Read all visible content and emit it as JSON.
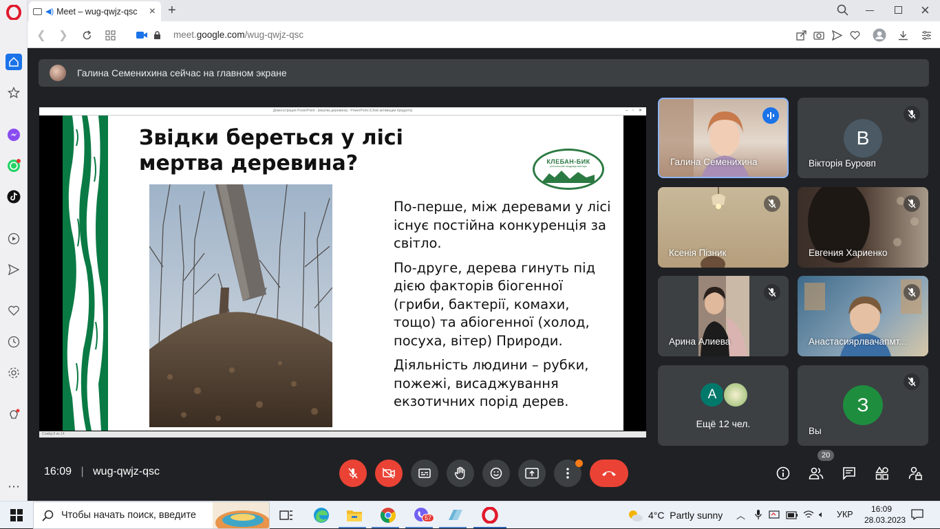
{
  "browser": {
    "tab_title": "Meet – wug-qwjz-qsc",
    "url_prefix": "meet.",
    "url_domain": "google.com",
    "url_path": "/wug-qwjz-qsc"
  },
  "sidebar": {
    "items": [
      "opera-logo",
      "home",
      "bookmarks",
      "messenger",
      "whatsapp",
      "tiktok",
      "player",
      "send",
      "favorites",
      "history",
      "settings",
      "ideas",
      "more"
    ]
  },
  "banner": {
    "text": "Галина Семенихина сейчас на главном экране"
  },
  "presentation": {
    "window_title": "Демонстрация PowerPoint - [мертва деревина] - PowerPoint (Сбой активации продукта)",
    "status_text": "Слайд 8 из 14",
    "slide": {
      "title_line1": "Звідки береться у лісі",
      "title_line2": "мертва деревина?",
      "logo_line1": "КЛЕБАН-БИК",
      "logo_line2": "регіональний ландшафтний парк",
      "paragraphs": [
        "По-перше, між деревами у лісі існує постійна конкуренція за світло.",
        "По-друге, дерева гинуть під дією факторів біогенної (гриби, бактерії, комахи, тощо) та абіогенної (холод, посуха, вітер) Природи.",
        "Діяльність людини – рубки, пожежі, висаджування екзотичних порід дерев."
      ]
    }
  },
  "participants": [
    {
      "name": "Галина Семенихина",
      "speaking": true
    },
    {
      "name": "Вікторія Буровп",
      "initial": "B",
      "color": "#4a5963"
    },
    {
      "name": "Ксенія Пізник"
    },
    {
      "name": "Евгения Хариенко"
    },
    {
      "name": "Арина Алиева"
    },
    {
      "name": "Анастасияp​лвачапмт..."
    },
    {
      "more_label": "Ещё 12 чел.",
      "initial": "A",
      "color": "#00796b"
    },
    {
      "name": "Вы",
      "initial": "З",
      "color": "#1e8e3e"
    }
  ],
  "controls": {
    "time": "16:09",
    "separator": "|",
    "meeting_code": "wug-qwjz-qsc",
    "people_count": "20"
  },
  "taskbar": {
    "search_placeholder": "Чтобы начать поиск, введите",
    "viber_badge": "57",
    "weather": "4°C  Partly sunny",
    "lang": "УКР",
    "time": "16:09",
    "date": "28.03.2023"
  }
}
